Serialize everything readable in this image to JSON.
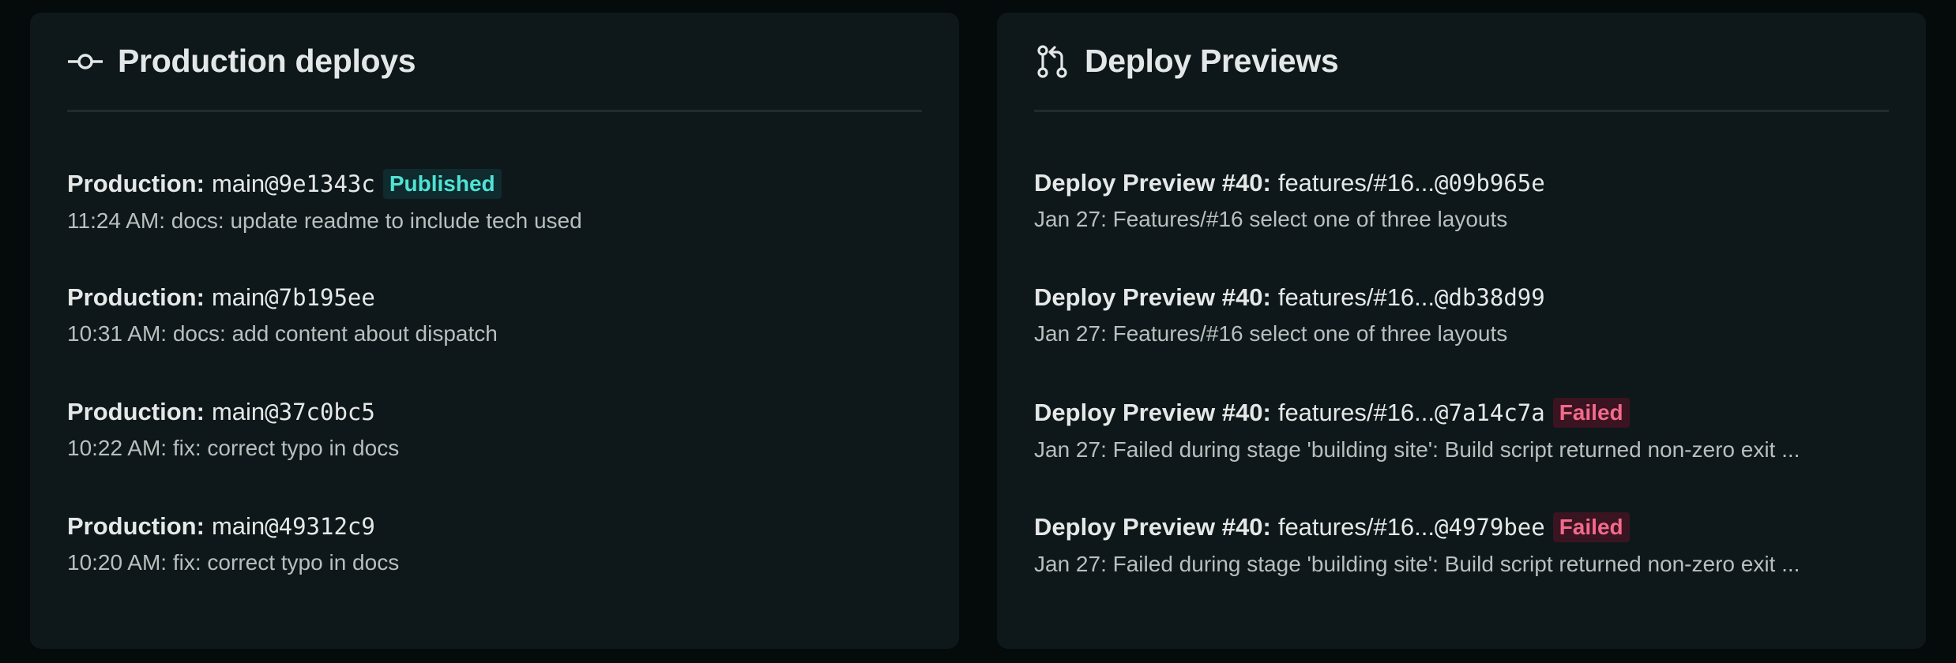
{
  "production": {
    "title": "Production deploys",
    "items": [
      {
        "context": "Production",
        "branch": "main",
        "sha": "9e1343c",
        "badge": "Published",
        "subtitle": "11:24 AM: docs: update readme to include tech used"
      },
      {
        "context": "Production",
        "branch": "main",
        "sha": "7b195ee",
        "badge": "",
        "subtitle": "10:31 AM: docs: add content about dispatch"
      },
      {
        "context": "Production",
        "branch": "main",
        "sha": "37c0bc5",
        "badge": "",
        "subtitle": "10:22 AM: fix: correct typo in docs"
      },
      {
        "context": "Production",
        "branch": "main",
        "sha": "49312c9",
        "badge": "",
        "subtitle": "10:20 AM: fix: correct typo in docs"
      }
    ]
  },
  "previews": {
    "title": "Deploy Previews",
    "items": [
      {
        "context": "Deploy Preview #40",
        "branch": "features/#16...",
        "sha": "09b965e",
        "badge": "",
        "subtitle": "Jan 27: Features/#16 select one of three layouts"
      },
      {
        "context": "Deploy Preview #40",
        "branch": "features/#16...",
        "sha": "db38d99",
        "badge": "",
        "subtitle": "Jan 27: Features/#16 select one of three layouts"
      },
      {
        "context": "Deploy Preview #40",
        "branch": "features/#16...",
        "sha": "7a14c7a",
        "badge": "Failed",
        "subtitle": "Jan 27: Failed during stage 'building site': Build script returned non-zero exit ..."
      },
      {
        "context": "Deploy Preview #40",
        "branch": "features/#16...",
        "sha": "4979bee",
        "badge": "Failed",
        "subtitle": "Jan 27: Failed during stage 'building site': Build script returned non-zero exit ..."
      }
    ]
  },
  "icons": {
    "production": "git-commit-icon",
    "previews": "git-pull-request-icon"
  },
  "colors": {
    "background": "#050a0b",
    "card": "#0e181a",
    "published": "#4fe3d6",
    "failed": "#f26a8c"
  }
}
